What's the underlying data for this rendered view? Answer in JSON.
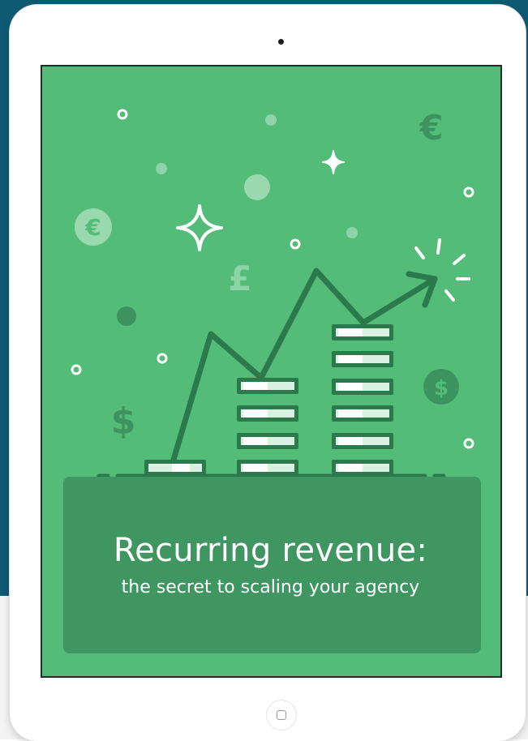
{
  "cover": {
    "title": "Recurring revenue:",
    "subtitle": "the secret to scaling your agency",
    "currency_symbols": {
      "euro": "€",
      "pound": "£",
      "dollar": "$"
    }
  },
  "colors": {
    "background_teal": "#0f5a73",
    "cover_green": "#52bc78",
    "dark_green": "#2c7a4b",
    "caption_box": "#3f9660",
    "light_green": "#a6dcb8",
    "white": "#ffffff"
  }
}
